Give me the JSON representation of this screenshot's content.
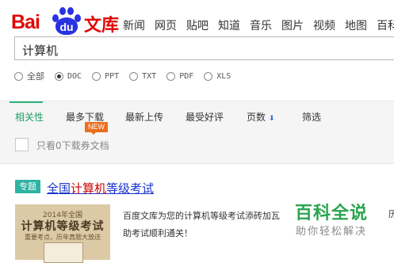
{
  "logo": {
    "bai": "Bai",
    "du": "du",
    "wenku": "文库"
  },
  "topnav": [
    "新闻",
    "网页",
    "贴吧",
    "知道",
    "音乐",
    "图片",
    "视频",
    "地图",
    "百科"
  ],
  "search": {
    "value": "计算机"
  },
  "file_types": [
    {
      "label": "全部",
      "selected": false
    },
    {
      "label": "DOC",
      "selected": true
    },
    {
      "label": "PPT",
      "selected": false
    },
    {
      "label": "TXT",
      "selected": false
    },
    {
      "label": "PDF",
      "selected": false
    },
    {
      "label": "XLS",
      "selected": false
    }
  ],
  "sorts": {
    "relevance": "相关性",
    "most_downloads": "最多下载",
    "latest": "最新上传",
    "top_rated": "最受好评",
    "pages": "页数",
    "filter": "筛选",
    "new_badge": "NEW",
    "free_only": "只看0下载券文档"
  },
  "topic": {
    "tag": "专题",
    "title_pre": "全国",
    "title_hl": "计算机",
    "title_post": "等级考试",
    "desc_line1": "百度文库为您的计算机等级考试添砖加瓦",
    "desc_line1_tail": "历",
    "desc_line2": "助考试顺利通关！",
    "cover_year": "2014年全国",
    "cover_title": "计算机等级考试",
    "cover_sub": "重要考点，历年真题大放送"
  },
  "watermark": {
    "title": "百科全说",
    "subtitle": "助你轻松解决"
  },
  "colors": {
    "brand_red": "#e10602",
    "brand_blue": "#2932e1",
    "accent_green": "#2db37c",
    "badge_orange": "#ea6f1e"
  }
}
